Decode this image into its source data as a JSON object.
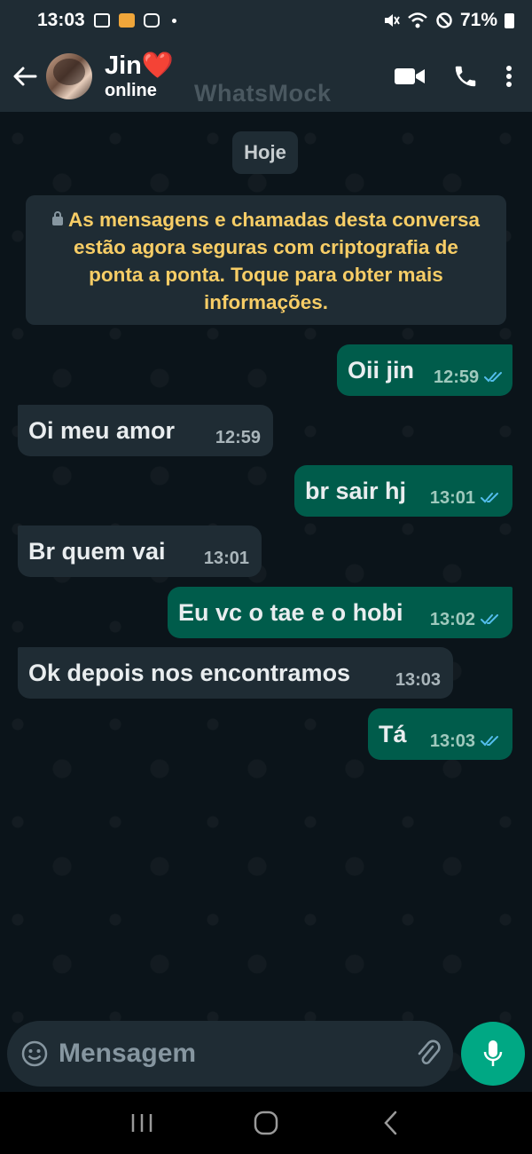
{
  "status_bar": {
    "time": "13:03",
    "battery": "71%",
    "icons": [
      "gallery-icon",
      "app-notification-icon",
      "instagram-icon",
      "dot-icon",
      "mute-icon",
      "wifi-icon",
      "do-not-disturb-icon",
      "battery-icon"
    ]
  },
  "header": {
    "contact_name": "Jin",
    "contact_emoji": "❤️",
    "status": "online",
    "watermark": "WhatsMock"
  },
  "chat": {
    "date_label": "Hoje",
    "encryption_notice": "As mensagens e chamadas desta conversa estão agora seguras com criptografia de ponta a ponta. Toque para obter mais informações.",
    "messages": [
      {
        "direction": "out",
        "text": "Oii jin",
        "time": "12:59",
        "read": true
      },
      {
        "direction": "in",
        "text": "Oi meu amor",
        "time": "12:59"
      },
      {
        "direction": "out",
        "text": "br sair hj",
        "time": "13:01",
        "read": true
      },
      {
        "direction": "in",
        "text": "Br quem vai",
        "time": "13:01"
      },
      {
        "direction": "out",
        "text": "Eu vc o tae e o hobi",
        "time": "13:02",
        "read": true
      },
      {
        "direction": "in",
        "text": "Ok depois nos encontramos",
        "time": "13:03"
      },
      {
        "direction": "out",
        "text": "Tá",
        "time": "13:03",
        "read": true
      }
    ]
  },
  "composer": {
    "placeholder": "Mensagem"
  },
  "colors": {
    "header_bg": "#1f2c34",
    "chat_bg": "#0b141a",
    "outgoing_bubble": "#005c4b",
    "incoming_bubble": "#1f2c34",
    "accent": "#00a884",
    "read_ticks": "#53bdeb",
    "encryption_text": "#f7cd66"
  }
}
